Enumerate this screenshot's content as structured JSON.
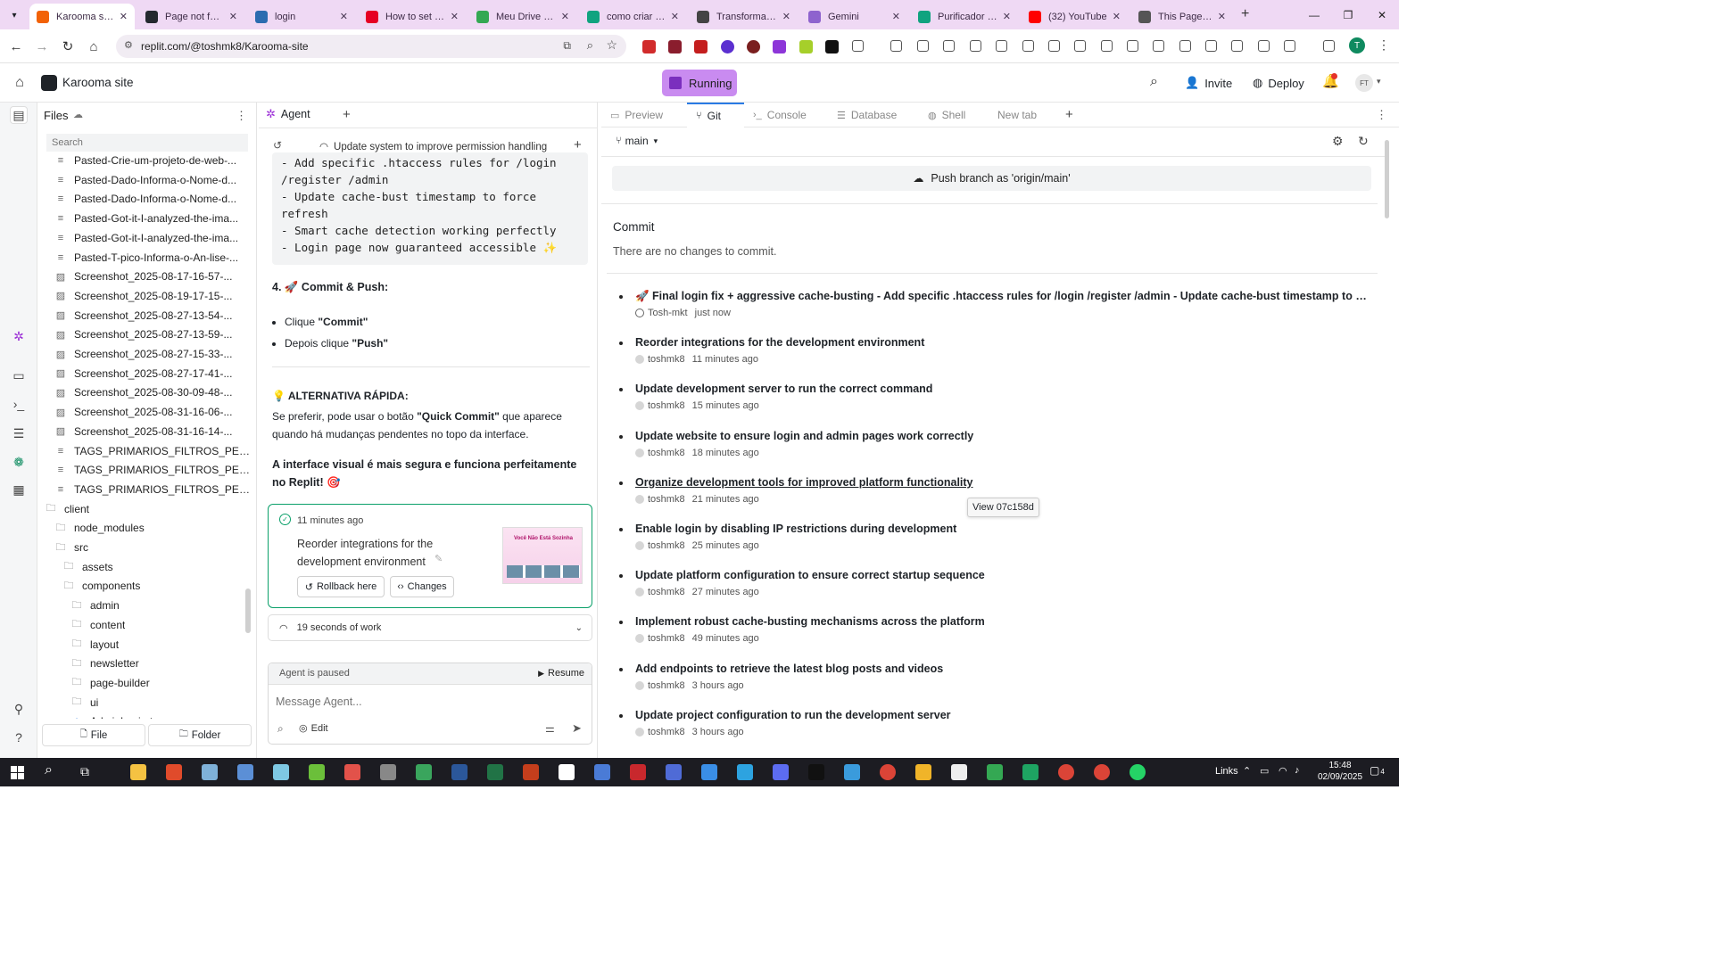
{
  "browser": {
    "tabs": [
      {
        "title": "Karooma site -",
        "color": "#f26207",
        "active": true
      },
      {
        "title": "Page not found",
        "color": "#24292f"
      },
      {
        "title": "login",
        "color": "#2b6cb0"
      },
      {
        "title": "How to set up",
        "color": "#e60023"
      },
      {
        "title": "Meu Drive - Go",
        "color": "#34a853"
      },
      {
        "title": "como criar esta",
        "color": "#10a37f"
      },
      {
        "title": "Transformar im",
        "color": "#444444"
      },
      {
        "title": "Gemini",
        "color": "#8e63ce"
      },
      {
        "title": "Purificador de",
        "color": "#10a37f"
      },
      {
        "title": "(32) YouTube",
        "color": "#ff0000"
      },
      {
        "title": "This Page Does",
        "color": "#555555"
      }
    ],
    "url": "replit.com/@toshmk8/Karooma-site"
  },
  "header": {
    "project_name": "Karooma site",
    "status": "Running",
    "invite": "Invite",
    "deploy": "Deploy",
    "avatar_initials": "FT"
  },
  "files": {
    "title": "Files",
    "search_placeholder": "Search",
    "items": [
      {
        "name": "Pasted-Crie-um-projeto-de-web-...",
        "type": "doc",
        "indent": 0
      },
      {
        "name": "Pasted-Dado-Informa-o-Nome-d...",
        "type": "doc",
        "indent": 0
      },
      {
        "name": "Pasted-Dado-Informa-o-Nome-d...",
        "type": "doc",
        "indent": 0
      },
      {
        "name": "Pasted-Got-it-I-analyzed-the-ima...",
        "type": "doc",
        "indent": 0
      },
      {
        "name": "Pasted-Got-it-I-analyzed-the-ima...",
        "type": "doc",
        "indent": 0
      },
      {
        "name": "Pasted-T-pico-Informa-o-An-lise-...",
        "type": "doc",
        "indent": 0
      },
      {
        "name": "Screenshot_2025-08-17-16-57-...",
        "type": "img",
        "indent": 0
      },
      {
        "name": "Screenshot_2025-08-19-17-15-...",
        "type": "img",
        "indent": 0
      },
      {
        "name": "Screenshot_2025-08-27-13-54-...",
        "type": "img",
        "indent": 0
      },
      {
        "name": "Screenshot_2025-08-27-13-59-...",
        "type": "img",
        "indent": 0
      },
      {
        "name": "Screenshot_2025-08-27-15-33-...",
        "type": "img",
        "indent": 0
      },
      {
        "name": "Screenshot_2025-08-27-17-41-...",
        "type": "img",
        "indent": 0
      },
      {
        "name": "Screenshot_2025-08-30-09-48-...",
        "type": "img",
        "indent": 0
      },
      {
        "name": "Screenshot_2025-08-31-16-06-...",
        "type": "img",
        "indent": 0
      },
      {
        "name": "Screenshot_2025-08-31-16-14-...",
        "type": "img",
        "indent": 0
      },
      {
        "name": "TAGS_PRIMARIOS_FILTROS_PES...",
        "type": "doc",
        "indent": 0
      },
      {
        "name": "TAGS_PRIMARIOS_FILTROS_PES...",
        "type": "doc",
        "indent": 0
      },
      {
        "name": "TAGS_PRIMARIOS_FILTROS_PES...",
        "type": "doc",
        "indent": 0
      },
      {
        "name": "client",
        "type": "folder",
        "indent": -1
      },
      {
        "name": "node_modules",
        "type": "folder",
        "indent": 0
      },
      {
        "name": "src",
        "type": "folder",
        "indent": 0
      },
      {
        "name": "assets",
        "type": "folder",
        "indent": 1
      },
      {
        "name": "components",
        "type": "folder",
        "indent": 1
      },
      {
        "name": "admin",
        "type": "folder",
        "indent": 2
      },
      {
        "name": "content",
        "type": "folder",
        "indent": 2
      },
      {
        "name": "layout",
        "type": "folder",
        "indent": 2
      },
      {
        "name": "newsletter",
        "type": "folder",
        "indent": 2
      },
      {
        "name": "page-builder",
        "type": "folder",
        "indent": 2
      },
      {
        "name": "ui",
        "type": "folder",
        "indent": 2
      },
      {
        "name": "AdminLogin.tsx",
        "type": "tsx",
        "indent": 2
      }
    ],
    "new_file": "File",
    "new_folder": "Folder"
  },
  "agent": {
    "tab_label": "Agent",
    "history_title": "Update system to improve permission handling",
    "code_lines": [
      "- Add specific .htaccess rules for /login",
      "/register /admin",
      "- Update cache-bust timestamp to force",
      "refresh",
      "- Smart cache detection working perfectly",
      "- Login page now guaranteed accessible ✨"
    ],
    "step_heading": "4. 🚀 Commit & Push:",
    "bullets": [
      {
        "pre": "Clique ",
        "bold": "\"Commit\""
      },
      {
        "pre": "Depois clique ",
        "bold": "\"Push\""
      }
    ],
    "alt_heading": "💡 ALTERNATIVA RÁPIDA:",
    "alt_text_pre": "Se preferir, pode usar o botão ",
    "alt_text_bold": "\"Quick Commit\"",
    "alt_text_post": " que aparece quando há mudanças pendentes no topo da interface.",
    "closing": "A interface visual é mais segura e funciona perfeitamente no Replit! 🎯",
    "checkpoint": {
      "time": "11 minutes ago",
      "title": "Reorder integrations for the development environment",
      "rollback": "Rollback here",
      "changes": "Changes",
      "thumb_text": "Você Não Está Sozinha"
    },
    "work_summary": "19 seconds of work",
    "paused": "Agent is paused",
    "resume": "Resume",
    "input_placeholder": "Message Agent...",
    "edit": "Edit"
  },
  "right_tabs": [
    "Preview",
    "Git",
    "Console",
    "Database",
    "Shell",
    "New tab"
  ],
  "git": {
    "branch": "main",
    "push_button": "Push branch as 'origin/main'",
    "commit_heading": "Commit",
    "no_changes": "There are no changes to commit.",
    "tooltip": "View 07c158d",
    "commits": [
      {
        "message": "🚀 Final login fix + aggressive cache-busting - Add specific .htaccess rules for /login /register /admin - Update cache-bust timestamp to forc...",
        "author": "Tosh-mkt",
        "time": "just now"
      },
      {
        "message": "Reorder integrations for the development environment",
        "author": "toshmk8",
        "time": "11 minutes ago"
      },
      {
        "message": "Update development server to run the correct command",
        "author": "toshmk8",
        "time": "15 minutes ago"
      },
      {
        "message": "Update website to ensure login and admin pages work correctly",
        "author": "toshmk8",
        "time": "18 minutes ago"
      },
      {
        "message": "Organize development tools for improved platform functionality",
        "author": "toshmk8",
        "time": "21 minutes ago"
      },
      {
        "message": "Enable login by disabling IP restrictions during development",
        "author": "toshmk8",
        "time": "25 minutes ago"
      },
      {
        "message": "Update platform configuration to ensure correct startup sequence",
        "author": "toshmk8",
        "time": "27 minutes ago"
      },
      {
        "message": "Implement robust cache-busting mechanisms across the platform",
        "author": "toshmk8",
        "time": "49 minutes ago"
      },
      {
        "message": "Add endpoints to retrieve the latest blog posts and videos",
        "author": "toshmk8",
        "time": "3 hours ago"
      },
      {
        "message": "Update project configuration to run the development server",
        "author": "toshmk8",
        "time": "3 hours ago"
      }
    ]
  },
  "taskbar": {
    "links": "Links",
    "time": "15:48",
    "date": "02/09/2025",
    "notifications": "4"
  },
  "colors": {
    "accent": "#f26207",
    "running_bg": "#c98bf0",
    "tab_strip": "#efd9f4",
    "taskbar": "#1c1c22"
  }
}
